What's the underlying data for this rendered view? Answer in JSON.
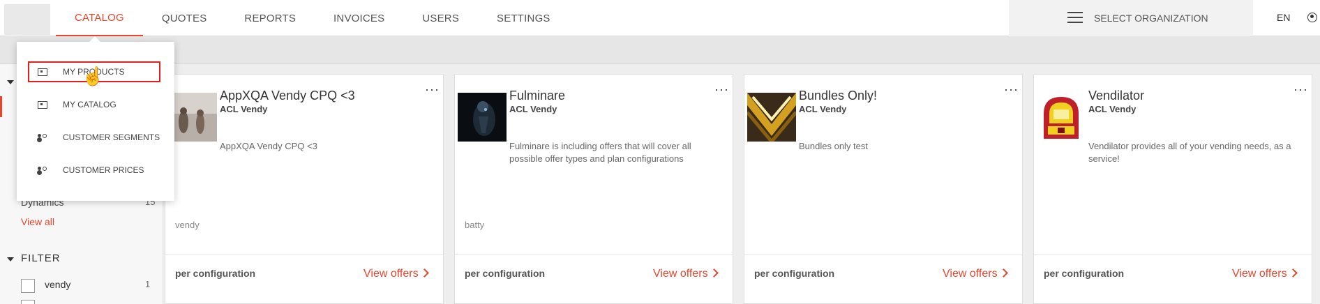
{
  "nav": {
    "items": [
      {
        "label": "CATALOG",
        "active": true
      },
      {
        "label": "QUOTES",
        "active": false
      },
      {
        "label": "REPORTS",
        "active": false
      },
      {
        "label": "INVOICES",
        "active": false
      },
      {
        "label": "USERS",
        "active": false
      },
      {
        "label": "SETTINGS",
        "active": false
      }
    ],
    "org_label": "SELECT ORGANIZATION",
    "lang": "EN"
  },
  "dropdown": {
    "items": [
      {
        "label": "MY PRODUCTS",
        "icon": "box-icon"
      },
      {
        "label": "MY CATALOG",
        "icon": "box-icon"
      },
      {
        "label": "CUSTOMER SEGMENTS",
        "icon": "people-icon"
      },
      {
        "label": "CUSTOMER PRICES",
        "icon": "people-icon"
      }
    ]
  },
  "sidebar": {
    "partial_row": "Dynamics",
    "partial_count": "15",
    "view_all": "View all",
    "filter_heading": "FILTER",
    "filters": [
      {
        "label": "vendy",
        "count": "1"
      }
    ]
  },
  "cards": [
    {
      "title": "AppXQA Vendy CPQ <3",
      "vendor": "ACL Vendy",
      "description": "AppXQA Vendy CPQ <3",
      "tag": "vendy",
      "price": "per configuration",
      "offers": "View offers"
    },
    {
      "title": "Fulminare",
      "vendor": "ACL Vendy",
      "description": "Fulminare is including offers that will cover all possible offer types and plan configurations",
      "tag": "batty",
      "price": "per configuration",
      "offers": "View offers"
    },
    {
      "title": "Bundles Only!",
      "vendor": "ACL Vendy",
      "description": "Bundles only test",
      "tag": "",
      "price": "per configuration",
      "offers": "View offers"
    },
    {
      "title": "Vendilator",
      "vendor": "ACL Vendy",
      "description": "Vendilator provides all of your vending needs, as a service!",
      "tag": "",
      "price": "per configuration",
      "offers": "View offers"
    }
  ],
  "colors": {
    "accent": "#e8452c",
    "highlight": "#e02020"
  }
}
